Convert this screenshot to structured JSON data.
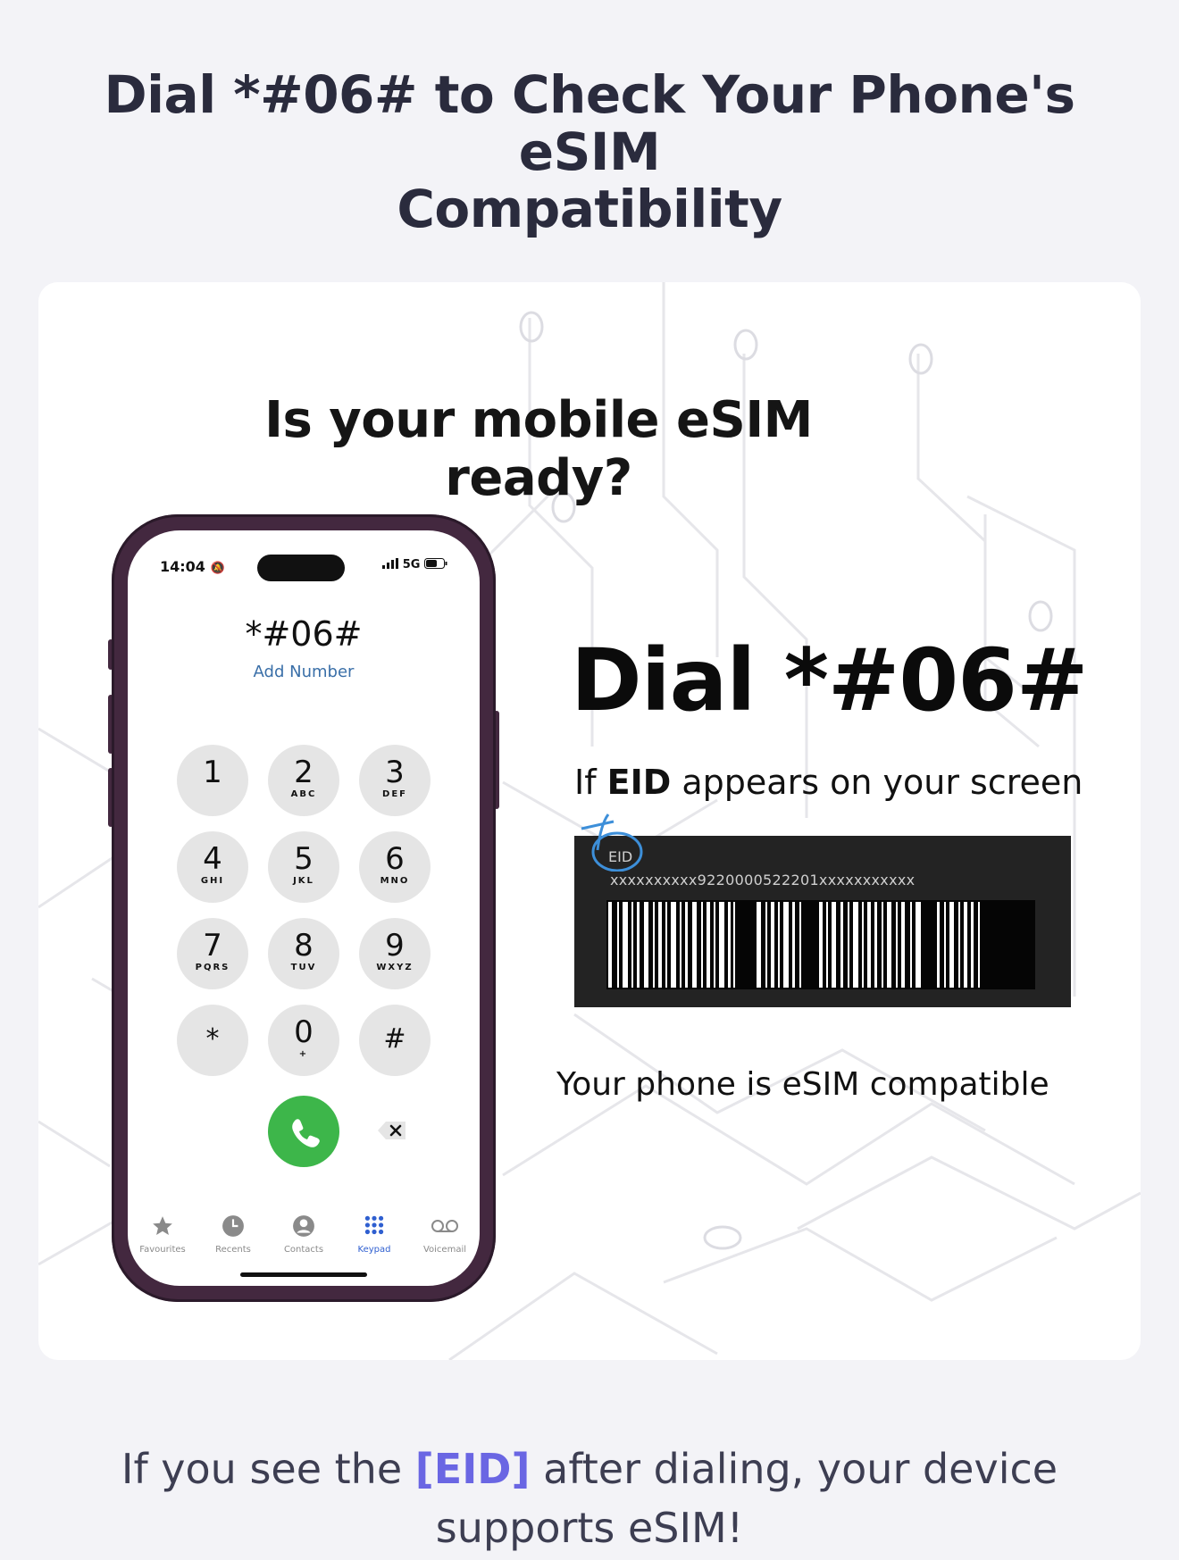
{
  "page": {
    "title_line1": "Dial *#06# to Check Your Phone's eSIM",
    "title_line2": "Compatibility"
  },
  "card": {
    "heading": "Is your mobile  eSIM ready?",
    "dial_instruction": "Dial *#06#",
    "eid_prefix": "If ",
    "eid_bold": "EID",
    "eid_suffix": " appears on your screen",
    "eid_label": "EID",
    "eid_number": "xxxxxxxxxx9220000522201xxxxxxxxxxx",
    "compatible_text": "Your phone is eSIM compatible"
  },
  "phone": {
    "status_time": "14:04",
    "status_network": "5G",
    "dialed_code": "*#06#",
    "add_number": "Add Number",
    "keys": [
      {
        "num": "1",
        "sub": ""
      },
      {
        "num": "2",
        "sub": "ABC"
      },
      {
        "num": "3",
        "sub": "DEF"
      },
      {
        "num": "4",
        "sub": "GHI"
      },
      {
        "num": "5",
        "sub": "JKL"
      },
      {
        "num": "6",
        "sub": "MNO"
      },
      {
        "num": "7",
        "sub": "PQRS"
      },
      {
        "num": "8",
        "sub": "TUV"
      },
      {
        "num": "9",
        "sub": "WXYZ"
      },
      {
        "num": "*",
        "sub": ""
      },
      {
        "num": "0",
        "sub": "+"
      },
      {
        "num": "#",
        "sub": ""
      }
    ],
    "tabs": [
      {
        "label": "Favourites",
        "icon": "star-icon"
      },
      {
        "label": "Recents",
        "icon": "clock-icon"
      },
      {
        "label": "Contacts",
        "icon": "contact-icon"
      },
      {
        "label": "Keypad",
        "icon": "keypad-icon",
        "active": true
      },
      {
        "label": "Voicemail",
        "icon": "voicemail-icon"
      }
    ],
    "call_color": "#3db64a",
    "active_tab_color": "#2f5fd0"
  },
  "footer": {
    "text_before": "If you see the ",
    "text_highlight": "[EID]",
    "text_after": " after dialing, your device supports eSIM!",
    "highlight_color": "#6a66e3"
  }
}
